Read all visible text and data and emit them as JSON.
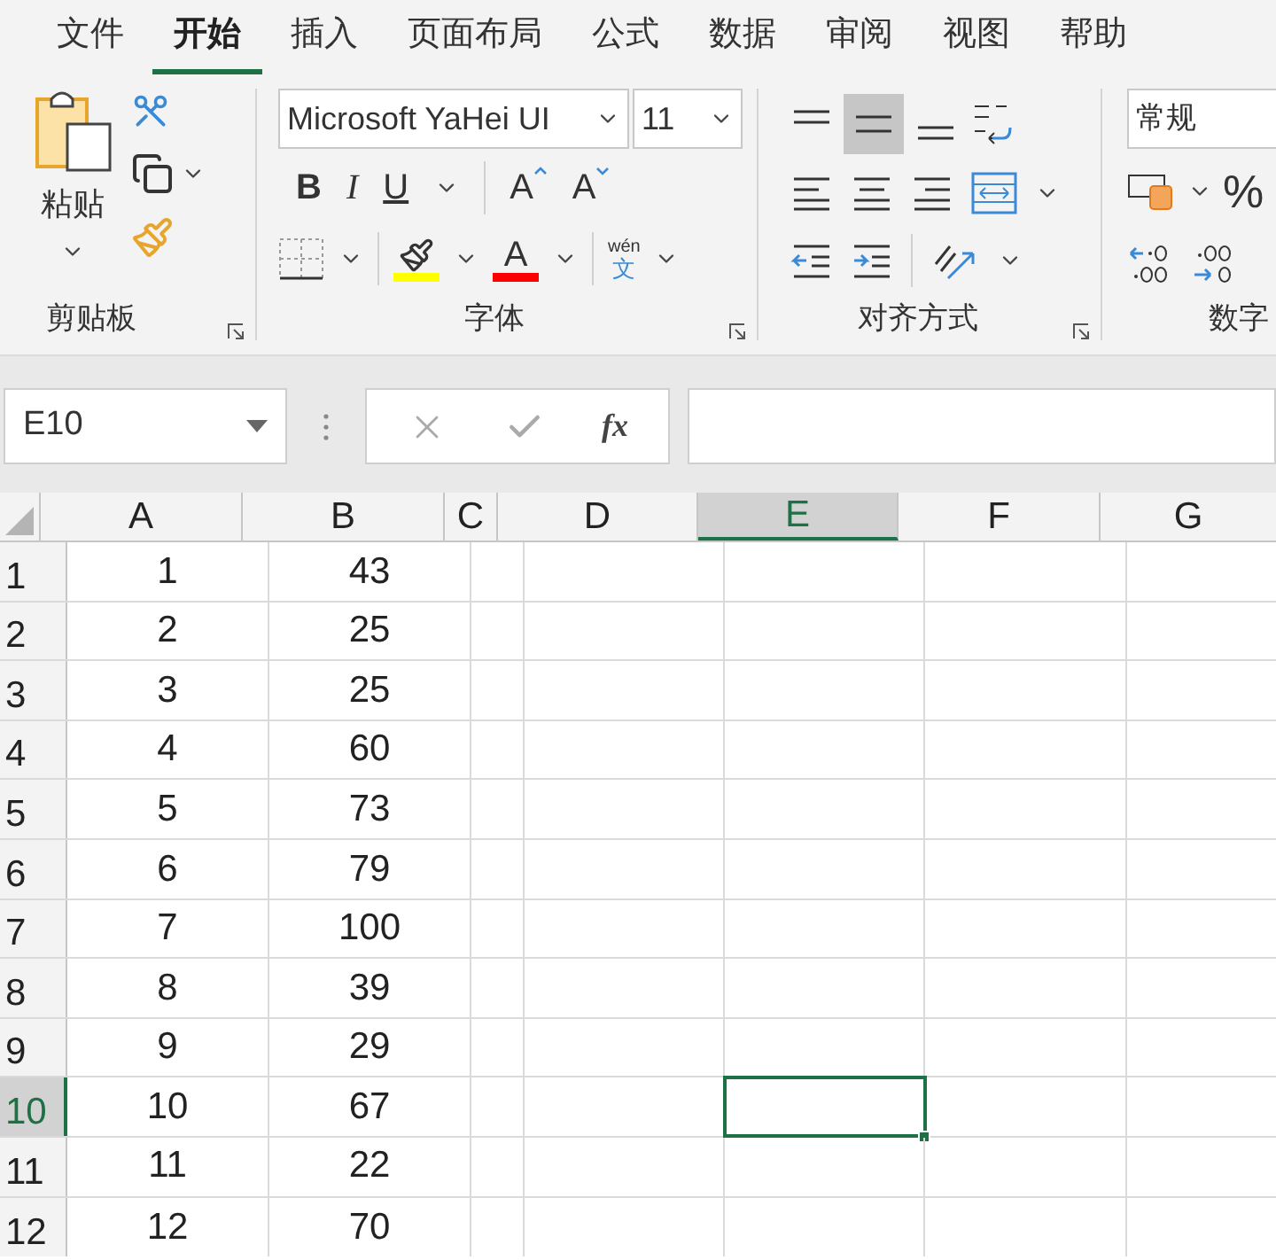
{
  "tabs": [
    {
      "label": "文件",
      "selected": false
    },
    {
      "label": "开始",
      "selected": true
    },
    {
      "label": "插入",
      "selected": false
    },
    {
      "label": "页面布局",
      "selected": false
    },
    {
      "label": "公式",
      "selected": false
    },
    {
      "label": "数据",
      "selected": false
    },
    {
      "label": "审阅",
      "selected": false
    },
    {
      "label": "视图",
      "selected": false
    },
    {
      "label": "帮助",
      "selected": false
    }
  ],
  "ribbon": {
    "clipboard": {
      "paste_label": "粘贴",
      "group_label": "剪贴板"
    },
    "font": {
      "font_name": "Microsoft YaHei UI",
      "font_size": "11",
      "bold": "B",
      "italic": "I",
      "underline": "U",
      "grow": "A",
      "shrink": "A",
      "font_color": "A",
      "phonetic_top": "wén",
      "phonetic_bottom": "文",
      "group_label": "字体"
    },
    "alignment": {
      "group_label": "对齐方式",
      "center_selected": true
    },
    "number": {
      "format": "常规",
      "percent": "%",
      "group_label": "数字"
    }
  },
  "formula_bar": {
    "name_box": "E10",
    "fx": "fx"
  },
  "columns": [
    {
      "label": "A",
      "selected": false
    },
    {
      "label": "B",
      "selected": false
    },
    {
      "label": "C",
      "selected": false
    },
    {
      "label": "D",
      "selected": false
    },
    {
      "label": "E",
      "selected": true
    },
    {
      "label": "F",
      "selected": false
    },
    {
      "label": "G",
      "selected": false
    }
  ],
  "rows": [
    {
      "label": "1",
      "selected": false,
      "cells": [
        "1",
        "43"
      ]
    },
    {
      "label": "2",
      "selected": false,
      "cells": [
        "2",
        "25"
      ]
    },
    {
      "label": "3",
      "selected": false,
      "cells": [
        "3",
        "25"
      ]
    },
    {
      "label": "4",
      "selected": false,
      "cells": [
        "4",
        "60"
      ]
    },
    {
      "label": "5",
      "selected": false,
      "cells": [
        "5",
        "73"
      ]
    },
    {
      "label": "6",
      "selected": false,
      "cells": [
        "6",
        "79"
      ]
    },
    {
      "label": "7",
      "selected": false,
      "cells": [
        "7",
        "100"
      ]
    },
    {
      "label": "8",
      "selected": false,
      "cells": [
        "8",
        "39"
      ]
    },
    {
      "label": "9",
      "selected": false,
      "cells": [
        "9",
        "29"
      ]
    },
    {
      "label": "10",
      "selected": true,
      "cells": [
        "10",
        "67"
      ]
    },
    {
      "label": "11",
      "selected": false,
      "cells": [
        "11",
        "22"
      ]
    },
    {
      "label": "12",
      "selected": false,
      "cells": [
        "12",
        "70"
      ]
    }
  ]
}
